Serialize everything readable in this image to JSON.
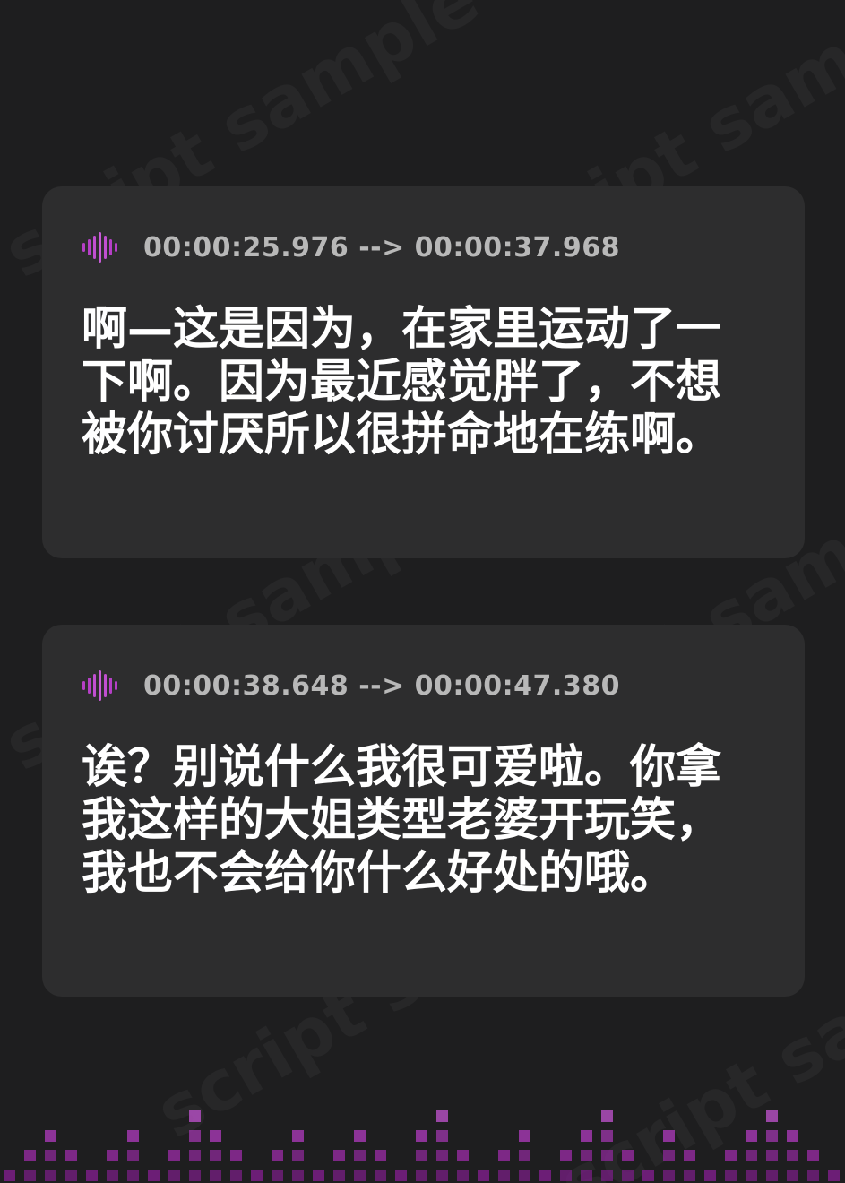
{
  "watermark": "script sample",
  "accent_color": "#b53fc6",
  "icons": {
    "timestamp": "audio-wave-icon",
    "footer": "equalizer-bars"
  },
  "cards": [
    {
      "timestamp": "00:00:25.976 --> 00:00:37.968",
      "lines": [
        "啊—这是因为，在家里运动了一",
        "下啊。因为最近感觉胖了，不想",
        "被你讨厌所以很拼命地在练啊。"
      ]
    },
    {
      "timestamp": "00:00:38.648 --> 00:00:47.380",
      "lines": [
        "诶？别说什么我很可爱啦。你拿",
        "我这样的大姐类型老婆开玩笑，",
        "我也不会给你什么好处的哦。"
      ]
    }
  ],
  "equalizer_levels": [
    1,
    2,
    3,
    2,
    1,
    2,
    3,
    1,
    2,
    4,
    3,
    2,
    1,
    2,
    3,
    1,
    2,
    3,
    2,
    1,
    3,
    4,
    2,
    1,
    2,
    3,
    1,
    2,
    3,
    4,
    2,
    1,
    3,
    2,
    1,
    2,
    3,
    4,
    3,
    2,
    1
  ]
}
